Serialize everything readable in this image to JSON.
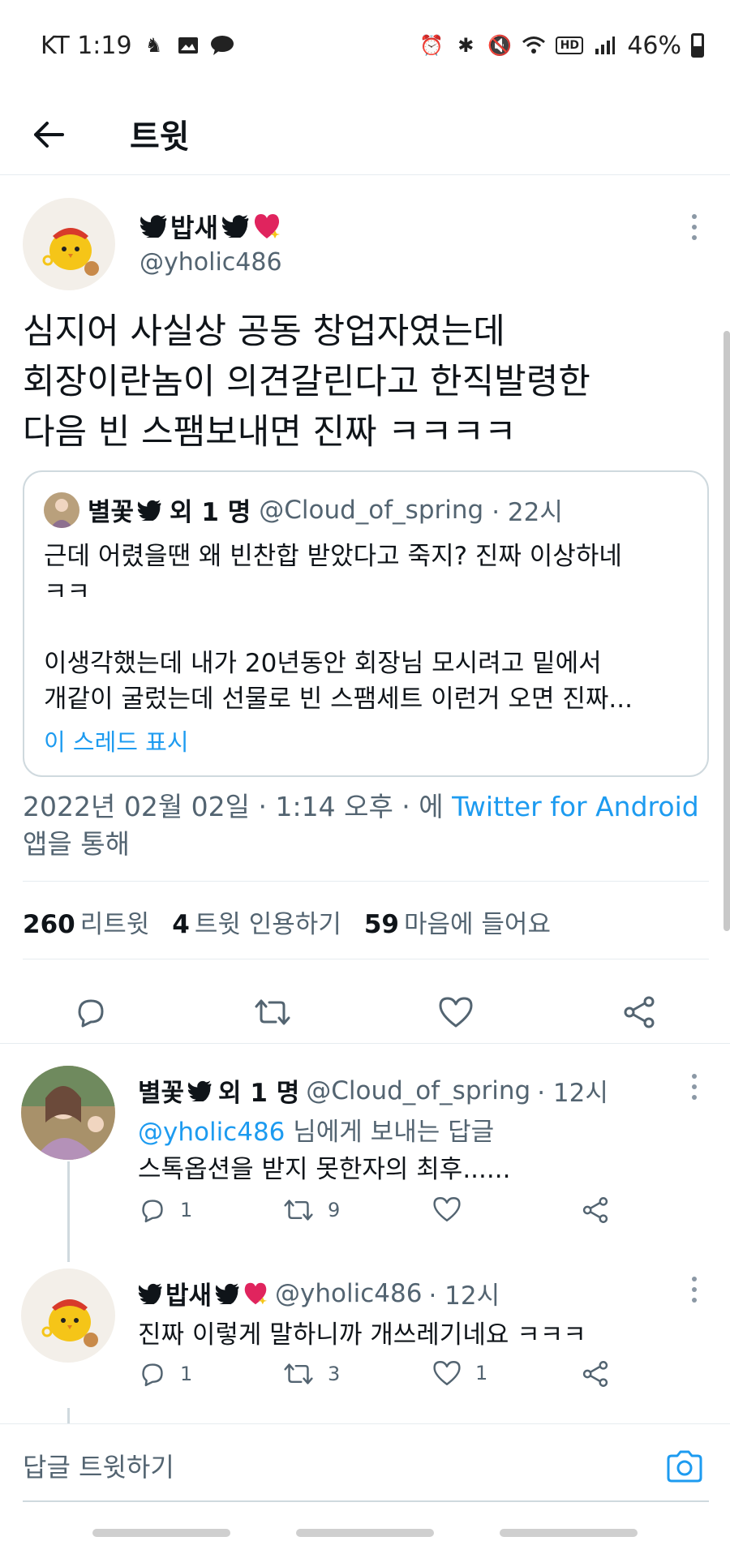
{
  "status_bar": {
    "carrier_time": "KT 1:19",
    "battery": "46%"
  },
  "header": {
    "title": "트윗"
  },
  "main_tweet": {
    "author_name": "밥새",
    "handle": "@yholic486",
    "text": "심지어 사실상 공동 창업자였는데\n회장이란놈이 의견갈린다고 한직발령한\n다음 빈 스팸보내면 진짜 ㅋㅋㅋㅋ",
    "quote": {
      "author_name": "별꽃",
      "others": "외 1 명",
      "handle": "@Cloud_of_spring",
      "time": "· 22시",
      "text": "근데 어렸을땐 왜 빈찬합 받았다고 죽지? 진짜 이상하네\nㅋㅋ\n\n이생각했는데 내가 20년동안 회장님 모시려고 밑에서\n개같이 굴렀는데 선물로 빈 스팸세트 이런거 오면 진짜...",
      "show_thread": "이 스레드 표시"
    },
    "timestamp": "2022년 02월 02일 · 1:14 오후 · 에",
    "app": "Twitter for Android",
    "timestamp_suffix": "앱을 통해",
    "stats": {
      "retweets_count": "260",
      "retweets_label": "리트윗",
      "quotes_count": "4",
      "quotes_label": "트윗 인용하기",
      "likes_count": "59",
      "likes_label": "마음에 들어요"
    }
  },
  "replies": [
    {
      "author_name": "별꽃",
      "others": "외 1 명",
      "handle": "@Cloud_of_spring",
      "time": "· 12시",
      "reply_to_mention": "@yholic486",
      "reply_to_suffix": "님에게 보내는 답글",
      "text": "스톡옵션을 받지 못한자의 최후......",
      "replies": "1",
      "retweets": "9",
      "likes": ""
    },
    {
      "author_name": "밥새",
      "handle": "@yholic486",
      "time": "· 12시",
      "text": "진짜 이렇게 말하니까 개쓰레기네요 ㅋㅋㅋ",
      "replies": "1",
      "retweets": "3",
      "likes": "1"
    }
  ],
  "compose": {
    "placeholder": "답글 트윗하기"
  },
  "colors": {
    "accent": "#1d9bf0",
    "text": "#0f1419",
    "muted": "#536471",
    "heart": "#e0245e"
  }
}
